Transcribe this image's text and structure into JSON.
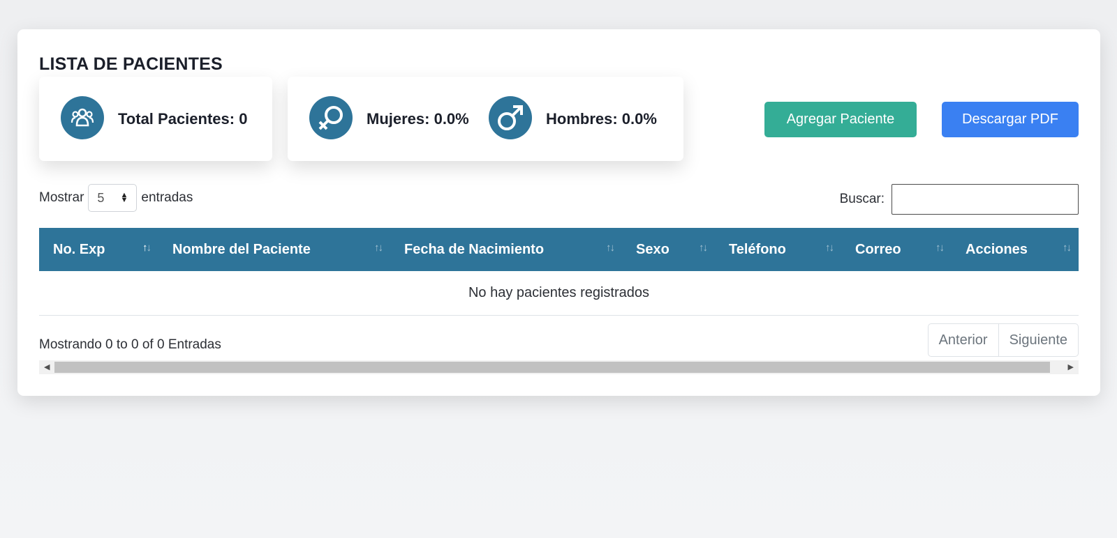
{
  "page": {
    "title": "LISTA DE PACIENTES"
  },
  "stats": {
    "total_label": "Total Pacientes: 0",
    "women_label": "Mujeres: 0.0%",
    "men_label": "Hombres: 0.0%"
  },
  "actions": {
    "add_label": "Agregar Paciente",
    "pdf_label": "Descargar PDF"
  },
  "table_controls": {
    "show_label": "Mostrar",
    "page_length": "5",
    "entries_label": "entradas",
    "search_label": "Buscar:",
    "search_value": ""
  },
  "table": {
    "columns": [
      "No. Exp",
      "Nombre del Paciente",
      "Fecha de Nacimiento",
      "Sexo",
      "Teléfono",
      "Correo",
      "Acciones"
    ],
    "empty_message": "No hay pacientes registrados"
  },
  "footer": {
    "info": "Mostrando 0 to 0 of 0 Entradas",
    "prev_label": "Anterior",
    "next_label": "Siguiente"
  },
  "colors": {
    "primary": "#2e7499",
    "add_button": "#34ad96",
    "pdf_button": "#3a80f2"
  },
  "icons": {
    "total": "users-icon",
    "women": "female-icon",
    "men": "male-icon"
  }
}
